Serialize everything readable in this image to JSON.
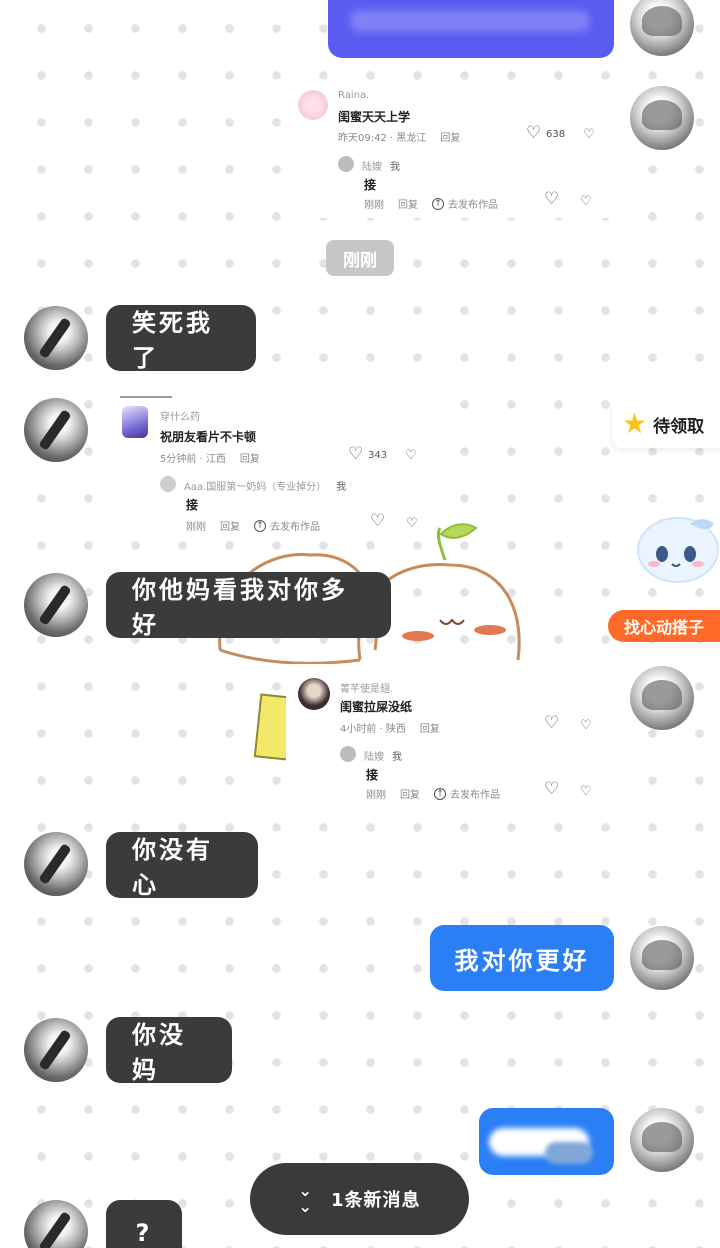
{
  "colors": {
    "incoming_bubble": "#3b3b3b",
    "outgoing_bubble": "#2b7ff5",
    "top_bubble": "#5a5cf0",
    "time_chip": "#c7c7c7",
    "accent_orange": "#ff6a2b",
    "star_yellow": "#ffc21a"
  },
  "time_divider": "刚刚",
  "messages": {
    "m1": "笑死我了",
    "m2": "你他妈看我对你多好",
    "m3": "你没有心",
    "m4": "我对你更好",
    "m5": "你没妈",
    "m6": "?"
  },
  "cards": {
    "card1": {
      "nickname": "Raina.",
      "text": "闺蜜天天上学",
      "meta_time": "昨天09:42 · 黑龙江",
      "reply_label": "回复",
      "likes": "638",
      "reply": {
        "nickname": "陆嫂",
        "author_tag": "我",
        "text": "接",
        "time": "刚刚",
        "reply_label": "回复",
        "publish_label": "去发布作品"
      }
    },
    "card2": {
      "nickname": "穿什么药",
      "text": "祝朋友看片不卡顿",
      "meta_time": "5分钟前 · 江西",
      "reply_label": "回复",
      "likes": "343",
      "reply": {
        "nickname": "Aaa.国服第一奶妈（专业掉分）",
        "author_tag": "我",
        "text": "接",
        "time": "刚刚",
        "reply_label": "回复",
        "publish_label": "去发布作品"
      }
    },
    "card3": {
      "nickname": "箐芊使是翅.",
      "text": "闺蜜拉屎没纸",
      "meta_time": "4小时前 · 陕西",
      "reply_label": "回复",
      "reply": {
        "nickname": "陆嫂",
        "author_tag": "我",
        "text": "接",
        "time": "刚刚",
        "reply_label": "回复",
        "publish_label": "去发布作品"
      }
    }
  },
  "side_widgets": {
    "pending_label": "待领取",
    "find_partner_label": "找心动搭子"
  },
  "new_message_banner": "1条新消息",
  "icons": {
    "heart": "heart-icon",
    "dislike": "dislike-icon",
    "upload": "upload-icon",
    "star": "star-icon",
    "chevrons": "double-chevron-down-icon"
  }
}
